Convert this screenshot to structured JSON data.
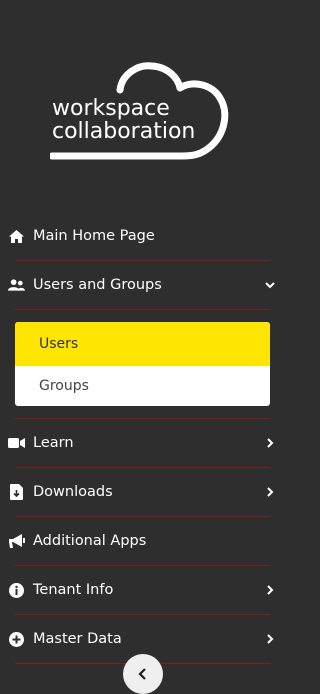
{
  "logo": {
    "line1": "workspace",
    "line2": "collaboration"
  },
  "menu": [
    {
      "label": "Main Home Page",
      "icon": "home-icon"
    },
    {
      "label": "Users and Groups",
      "icon": "users-icon",
      "expanded": true,
      "children": [
        {
          "label": "Users",
          "active": true
        },
        {
          "label": "Groups"
        }
      ]
    },
    {
      "label": "Learn",
      "icon": "video-icon"
    },
    {
      "label": "Downloads",
      "icon": "download-file-icon"
    },
    {
      "label": "Additional Apps",
      "icon": "megaphone-icon"
    },
    {
      "label": "Tenant Info",
      "icon": "info-icon"
    },
    {
      "label": "Master Data",
      "icon": "plus-circle-icon"
    }
  ],
  "colors": {
    "background": "#2e2e2e",
    "active": "#ffe500",
    "separator": "#8a1a1a"
  },
  "collapse": {
    "icon": "chevron-left-icon"
  }
}
